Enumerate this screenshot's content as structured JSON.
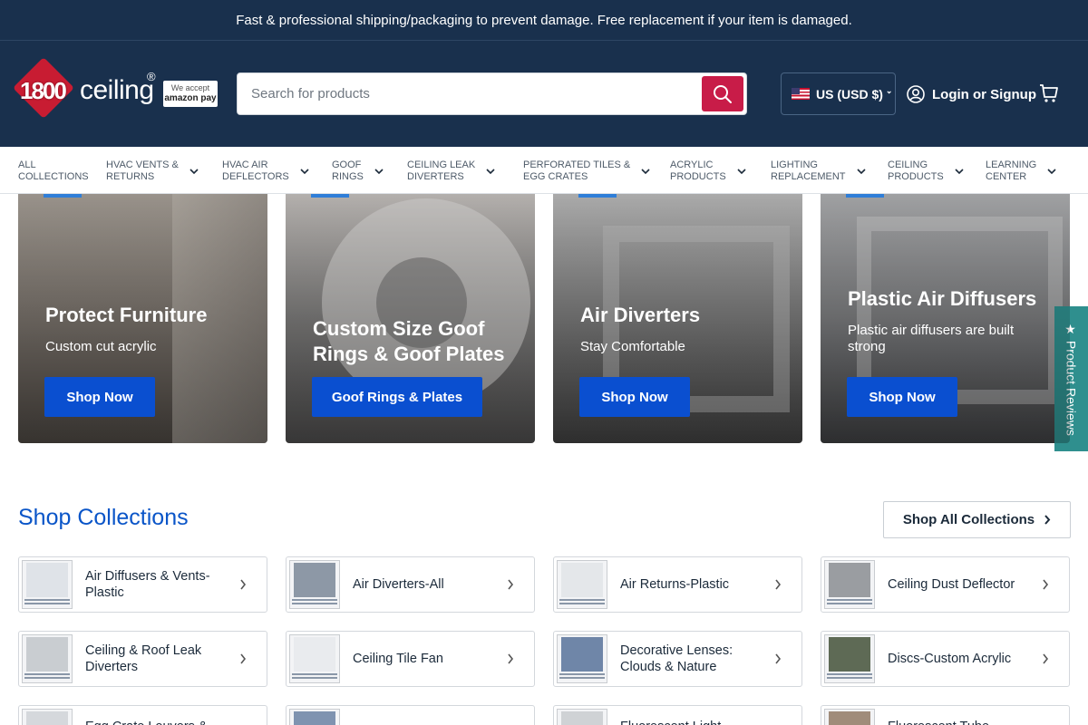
{
  "announcement": "Fast & professional shipping/packaging to prevent damage. Free replacement if your item is damaged.",
  "header": {
    "logo_number": "1800",
    "logo_word": "ceiling",
    "logo_reg": "®",
    "amazon_line1": "We accept",
    "amazon_line2": "amazon pay",
    "search_placeholder": "Search for products",
    "currency": "US (USD $)",
    "account": "Login or Signup"
  },
  "nav": [
    {
      "label": "All\nCollections",
      "has_dropdown": false
    },
    {
      "label": "HVAC Vents &\nReturns",
      "has_dropdown": true
    },
    {
      "label": "HVAC Air\nDeflectors",
      "has_dropdown": true
    },
    {
      "label": "Goof\nRings",
      "has_dropdown": true
    },
    {
      "label": "Ceiling Leak\nDiverters",
      "has_dropdown": true
    },
    {
      "label": "Perforated Tiles &\nEgg Crates",
      "has_dropdown": true
    },
    {
      "label": "Acrylic\nProducts",
      "has_dropdown": true
    },
    {
      "label": "Lighting\nReplacement",
      "has_dropdown": true
    },
    {
      "label": "Ceiling\nProducts",
      "has_dropdown": true
    },
    {
      "label": "Learning\nCenter",
      "has_dropdown": true
    }
  ],
  "promos": [
    {
      "title": "Protect Furniture",
      "subtitle": "Custom cut acrylic",
      "button": "Shop Now"
    },
    {
      "title": "Custom Size Goof Rings & Goof Plates",
      "subtitle": "",
      "button": "Goof Rings & Plates"
    },
    {
      "title": "Air Diverters",
      "subtitle": "Stay Comfortable",
      "button": "Shop Now"
    },
    {
      "title": "Plastic Air Diffusers",
      "subtitle": "Plastic air diffusers are built strong",
      "button": "Shop Now"
    }
  ],
  "collections_section": {
    "title": "Shop Collections",
    "shop_all": "Shop All Collections"
  },
  "collections": [
    "Air Diffusers & Vents-Plastic",
    "Air Diverters-All",
    "Air Returns-Plastic",
    "Ceiling Dust Deflector",
    "Ceiling & Roof Leak Diverters",
    "Ceiling Tile Fan",
    "Decorative Lenses: Clouds & Nature",
    "Discs-Custom Acrylic",
    "Egg Crate Louvers &",
    "",
    "Fluorescent Light",
    "Fluorescent Tube"
  ],
  "reviews_tab": "★ Product Reviews",
  "colors": {
    "header_bg": "#19304d",
    "search_button": "#c81c48",
    "cta_button": "#0a4fd0",
    "section_title": "#0a55c8",
    "reviews_tab": "#2f8f8e"
  }
}
